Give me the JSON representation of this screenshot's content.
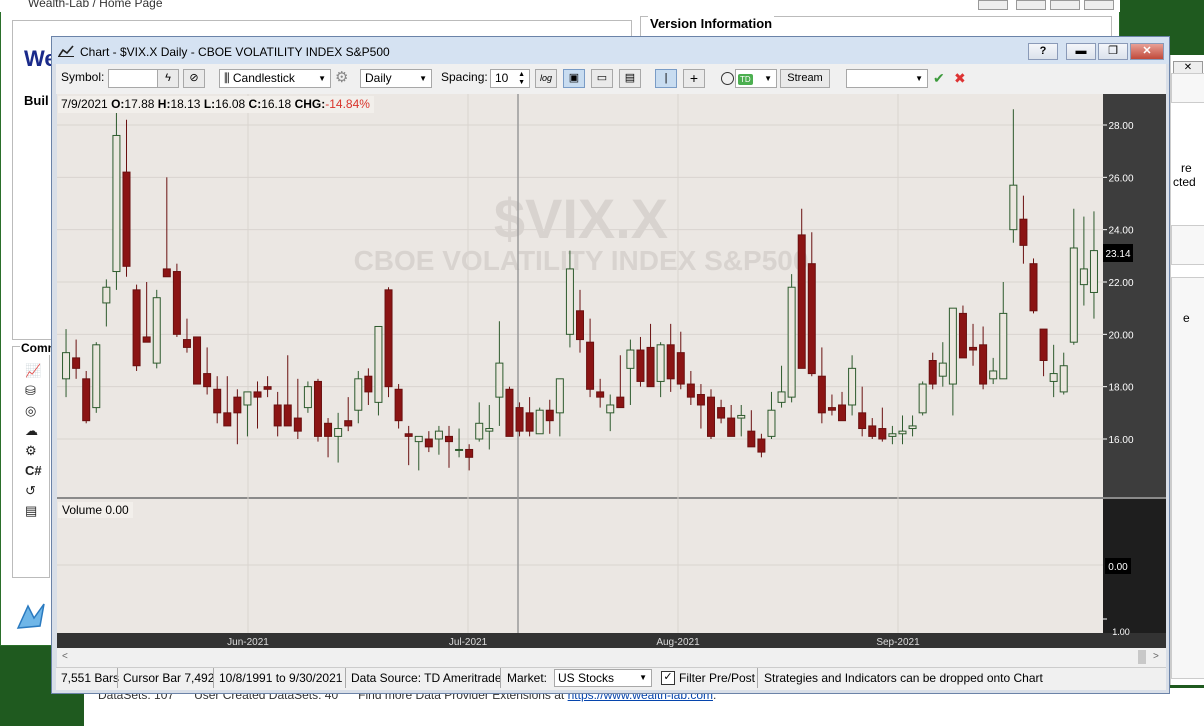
{
  "home": {
    "title": "Wealth-Lab / Home Page",
    "heading_fragment": "We",
    "build_fragment": "Buil",
    "comm_fragment": "Comm",
    "version_title": "Version Information",
    "right_fragment_1": "re",
    "right_fragment_2": "cted",
    "right_fragment_3": "e",
    "bottom_text_1": "DataSets: 107",
    "bottom_text_2": "User Created DataSets: 40",
    "bottom_text_3": "Find more Data Provider Extensions at",
    "bottom_link": "https://www.wealth-lab.com",
    "side_letters": [
      "W",
      "",
      "C",
      "E",
      "C",
      "C",
      "C",
      "S"
    ]
  },
  "chart_window": {
    "title": "Chart - $VIX.X Daily - CBOE VOLATILITY INDEX S&P500",
    "help_label": "?"
  },
  "toolbar": {
    "symbol_label": "Symbol:",
    "symbol_value": "",
    "chart_style": "Candlestick",
    "scale": "Daily",
    "spacing_label": "Spacing:",
    "spacing_value": "10",
    "log_label": "log",
    "stream_label": "Stream",
    "td_label": "TD",
    "strategy_select": ""
  },
  "ohlc": {
    "date": "7/9/2021",
    "o_label": "O:",
    "o": "17.88",
    "h_label": "H:",
    "h": "18.13",
    "l_label": "L:",
    "l": "16.08",
    "c_label": "C:",
    "c": "16.18",
    "chg_label": "CHG:",
    "chg": "-14.84%"
  },
  "watermark": {
    "symbol": "$VIX.X",
    "name": "CBOE VOLATILITY INDEX S&P500"
  },
  "price_axis": {
    "ticks": [
      "28.00",
      "26.00",
      "24.00",
      "22.00",
      "20.00",
      "18.00",
      "16.00"
    ],
    "current_price": "23.14"
  },
  "volume": {
    "label": "Volume 0.00",
    "axis_value": "0.00",
    "axis_bottom": "1.00"
  },
  "date_axis": {
    "labels": [
      "Jun-2021",
      "Jul-2021",
      "Aug-2021",
      "Sep-2021"
    ]
  },
  "status": {
    "bars": "7,551 Bars",
    "cursor": "Cursor Bar 7,492",
    "range": "10/8/1991 to 9/30/2021",
    "source": "Data Source: TD Ameritrade",
    "market_label": "Market:",
    "market_value": "US Stocks",
    "filter_label": "Filter Pre/Post",
    "hint": "Strategies and Indicators can be dropped onto Chart"
  },
  "colors": {
    "up_candle": "#ece7df",
    "down_candle": "#8b1414",
    "chg_negative": "#d9342b",
    "plot_bg": "#ebe7e3"
  },
  "chart_data": {
    "type": "candlestick",
    "symbol": "$VIX.X",
    "ylim": [
      14.5,
      29
    ],
    "candles": [
      {
        "o": 18.3,
        "h": 20.2,
        "l": 17.6,
        "c": 19.3
      },
      {
        "o": 19.1,
        "h": 19.8,
        "l": 18.3,
        "c": 18.7
      },
      {
        "o": 18.3,
        "h": 18.6,
        "l": 16.6,
        "c": 16.7
      },
      {
        "o": 17.2,
        "h": 19.7,
        "l": 17.0,
        "c": 19.6
      },
      {
        "o": 21.2,
        "h": 22.1,
        "l": 20.3,
        "c": 21.8
      },
      {
        "o": 22.4,
        "h": 28.5,
        "l": 21.7,
        "c": 27.6
      },
      {
        "o": 26.2,
        "h": 28.2,
        "l": 22.2,
        "c": 22.6
      },
      {
        "o": 21.7,
        "h": 21.9,
        "l": 18.6,
        "c": 18.8
      },
      {
        "o": 19.9,
        "h": 22.0,
        "l": 19.8,
        "c": 19.7
      },
      {
        "o": 18.9,
        "h": 21.7,
        "l": 18.7,
        "c": 21.4
      },
      {
        "o": 22.5,
        "h": 26.0,
        "l": 22.2,
        "c": 22.2
      },
      {
        "o": 22.4,
        "h": 22.7,
        "l": 19.9,
        "c": 20.0
      },
      {
        "o": 19.8,
        "h": 20.6,
        "l": 19.3,
        "c": 19.5
      },
      {
        "o": 19.9,
        "h": 19.9,
        "l": 18.7,
        "c": 18.1
      },
      {
        "o": 18.5,
        "h": 19.5,
        "l": 17.7,
        "c": 18.0
      },
      {
        "o": 17.9,
        "h": 18.4,
        "l": 16.6,
        "c": 17.0
      },
      {
        "o": 17.0,
        "h": 18.4,
        "l": 16.6,
        "c": 16.5
      },
      {
        "o": 17.6,
        "h": 17.9,
        "l": 15.8,
        "c": 17.0
      },
      {
        "o": 17.3,
        "h": 17.3,
        "l": 16.1,
        "c": 17.8
      },
      {
        "o": 17.8,
        "h": 18.2,
        "l": 16.4,
        "c": 17.6
      },
      {
        "o": 18.0,
        "h": 18.4,
        "l": 17.6,
        "c": 17.9
      },
      {
        "o": 17.3,
        "h": 17.8,
        "l": 16.1,
        "c": 16.5
      },
      {
        "o": 17.3,
        "h": 19.2,
        "l": 16.5,
        "c": 16.5
      },
      {
        "o": 16.8,
        "h": 18.3,
        "l": 16.0,
        "c": 16.3
      },
      {
        "o": 17.2,
        "h": 18.2,
        "l": 17.0,
        "c": 18.0
      },
      {
        "o": 18.2,
        "h": 18.3,
        "l": 15.9,
        "c": 16.1
      },
      {
        "o": 16.6,
        "h": 16.8,
        "l": 15.3,
        "c": 16.1
      },
      {
        "o": 16.1,
        "h": 17.0,
        "l": 15.1,
        "c": 16.4
      },
      {
        "o": 16.7,
        "h": 17.6,
        "l": 16.3,
        "c": 16.5
      },
      {
        "o": 17.1,
        "h": 18.6,
        "l": 16.6,
        "c": 18.3
      },
      {
        "o": 18.4,
        "h": 18.7,
        "l": 17.3,
        "c": 17.8
      },
      {
        "o": 17.4,
        "h": 20.0,
        "l": 16.9,
        "c": 20.3
      },
      {
        "o": 21.7,
        "h": 21.8,
        "l": 17.6,
        "c": 18.0
      },
      {
        "o": 17.9,
        "h": 18.1,
        "l": 16.4,
        "c": 16.7
      },
      {
        "o": 16.2,
        "h": 16.5,
        "l": 15.0,
        "c": 16.1
      },
      {
        "o": 15.9,
        "h": 16.0,
        "l": 14.8,
        "c": 16.1
      },
      {
        "o": 16.0,
        "h": 16.3,
        "l": 15.5,
        "c": 15.7
      },
      {
        "o": 16.0,
        "h": 16.5,
        "l": 15.4,
        "c": 16.3
      },
      {
        "o": 16.1,
        "h": 16.5,
        "l": 14.9,
        "c": 15.9
      },
      {
        "o": 15.6,
        "h": 16.4,
        "l": 15.3,
        "c": 15.6
      },
      {
        "o": 15.6,
        "h": 15.8,
        "l": 14.8,
        "c": 15.3
      },
      {
        "o": 16.0,
        "h": 17.4,
        "l": 15.9,
        "c": 16.6
      },
      {
        "o": 16.3,
        "h": 17.3,
        "l": 15.6,
        "c": 16.4
      },
      {
        "o": 17.6,
        "h": 20.5,
        "l": 16.5,
        "c": 18.9
      },
      {
        "o": 17.9,
        "h": 18.0,
        "l": 16.1,
        "c": 16.1
      },
      {
        "o": 17.2,
        "h": 17.4,
        "l": 16.1,
        "c": 16.3
      },
      {
        "o": 17.0,
        "h": 17.6,
        "l": 16.1,
        "c": 16.3
      },
      {
        "o": 16.2,
        "h": 17.2,
        "l": 16.5,
        "c": 17.1
      },
      {
        "o": 17.1,
        "h": 17.5,
        "l": 16.2,
        "c": 16.7
      },
      {
        "o": 17.0,
        "h": 18.3,
        "l": 16.1,
        "c": 18.3
      },
      {
        "o": 20.0,
        "h": 23.2,
        "l": 19.5,
        "c": 22.5
      },
      {
        "o": 20.9,
        "h": 21.7,
        "l": 19.3,
        "c": 19.8
      },
      {
        "o": 19.7,
        "h": 20.6,
        "l": 17.6,
        "c": 17.9
      },
      {
        "o": 17.8,
        "h": 18.3,
        "l": 17.2,
        "c": 17.6
      },
      {
        "o": 17.0,
        "h": 17.7,
        "l": 16.3,
        "c": 17.3
      },
      {
        "o": 17.6,
        "h": 19.2,
        "l": 17.5,
        "c": 17.2
      },
      {
        "o": 18.7,
        "h": 19.8,
        "l": 17.3,
        "c": 19.4
      },
      {
        "o": 19.4,
        "h": 19.9,
        "l": 18.0,
        "c": 18.2
      },
      {
        "o": 19.5,
        "h": 20.4,
        "l": 18.3,
        "c": 18.0
      },
      {
        "o": 18.2,
        "h": 19.7,
        "l": 17.6,
        "c": 19.6
      },
      {
        "o": 19.6,
        "h": 20.4,
        "l": 17.8,
        "c": 18.3
      },
      {
        "o": 19.3,
        "h": 20.1,
        "l": 17.9,
        "c": 18.1
      },
      {
        "o": 18.1,
        "h": 18.6,
        "l": 17.3,
        "c": 17.6
      },
      {
        "o": 17.7,
        "h": 18.1,
        "l": 16.4,
        "c": 17.3
      },
      {
        "o": 17.6,
        "h": 17.9,
        "l": 16.0,
        "c": 16.1
      },
      {
        "o": 17.2,
        "h": 17.5,
        "l": 16.6,
        "c": 16.8
      },
      {
        "o": 16.8,
        "h": 17.3,
        "l": 16.2,
        "c": 16.1
      },
      {
        "o": 16.8,
        "h": 17.3,
        "l": 16.1,
        "c": 16.9
      },
      {
        "o": 16.3,
        "h": 17.1,
        "l": 15.9,
        "c": 15.7
      },
      {
        "o": 16.0,
        "h": 16.2,
        "l": 15.3,
        "c": 15.5
      },
      {
        "o": 16.1,
        "h": 17.8,
        "l": 16.0,
        "c": 17.1
      },
      {
        "o": 17.4,
        "h": 18.8,
        "l": 17.2,
        "c": 17.8
      },
      {
        "o": 17.6,
        "h": 22.3,
        "l": 17.4,
        "c": 21.8
      },
      {
        "o": 23.8,
        "h": 24.8,
        "l": 20.9,
        "c": 18.7
      },
      {
        "o": 22.7,
        "h": 23.9,
        "l": 18.4,
        "c": 18.5
      },
      {
        "o": 18.4,
        "h": 19.5,
        "l": 16.6,
        "c": 17.0
      },
      {
        "o": 17.2,
        "h": 17.7,
        "l": 16.9,
        "c": 17.1
      },
      {
        "o": 17.3,
        "h": 17.8,
        "l": 16.8,
        "c": 16.7
      },
      {
        "o": 17.3,
        "h": 19.2,
        "l": 16.9,
        "c": 18.7
      },
      {
        "o": 17.0,
        "h": 18.0,
        "l": 16.1,
        "c": 16.4
      },
      {
        "o": 16.5,
        "h": 16.8,
        "l": 16.0,
        "c": 16.1
      },
      {
        "o": 16.4,
        "h": 17.2,
        "l": 15.9,
        "c": 16.0
      },
      {
        "o": 16.1,
        "h": 16.5,
        "l": 15.8,
        "c": 16.2
      },
      {
        "o": 16.2,
        "h": 16.9,
        "l": 15.8,
        "c": 16.3
      },
      {
        "o": 16.4,
        "h": 16.9,
        "l": 16.1,
        "c": 16.5
      },
      {
        "o": 17.0,
        "h": 18.2,
        "l": 16.9,
        "c": 18.1
      },
      {
        "o": 19.0,
        "h": 19.3,
        "l": 17.9,
        "c": 18.1
      },
      {
        "o": 18.4,
        "h": 19.7,
        "l": 18.0,
        "c": 18.9
      },
      {
        "o": 18.1,
        "h": 21.0,
        "l": 16.9,
        "c": 21.0
      },
      {
        "o": 20.8,
        "h": 21.1,
        "l": 19.2,
        "c": 19.1
      },
      {
        "o": 19.5,
        "h": 20.4,
        "l": 18.8,
        "c": 19.4
      },
      {
        "o": 19.6,
        "h": 20.3,
        "l": 17.9,
        "c": 18.1
      },
      {
        "o": 18.3,
        "h": 19.1,
        "l": 18.1,
        "c": 18.6
      },
      {
        "o": 18.3,
        "h": 22.0,
        "l": 18.3,
        "c": 20.8
      },
      {
        "o": 24.0,
        "h": 28.6,
        "l": 23.5,
        "c": 25.7
      },
      {
        "o": 24.4,
        "h": 25.3,
        "l": 22.7,
        "c": 23.4
      },
      {
        "o": 22.7,
        "h": 22.9,
        "l": 20.8,
        "c": 20.9
      },
      {
        "o": 20.2,
        "h": 20.1,
        "l": 18.4,
        "c": 19.0
      },
      {
        "o": 18.2,
        "h": 19.6,
        "l": 17.6,
        "c": 18.5
      },
      {
        "o": 17.8,
        "h": 19.3,
        "l": 17.7,
        "c": 18.8
      },
      {
        "o": 19.7,
        "h": 24.8,
        "l": 19.6,
        "c": 23.3
      },
      {
        "o": 21.9,
        "h": 24.5,
        "l": 21.1,
        "c": 22.5
      },
      {
        "o": 21.6,
        "h": 24.7,
        "l": 20.6,
        "c": 23.2
      }
    ]
  }
}
